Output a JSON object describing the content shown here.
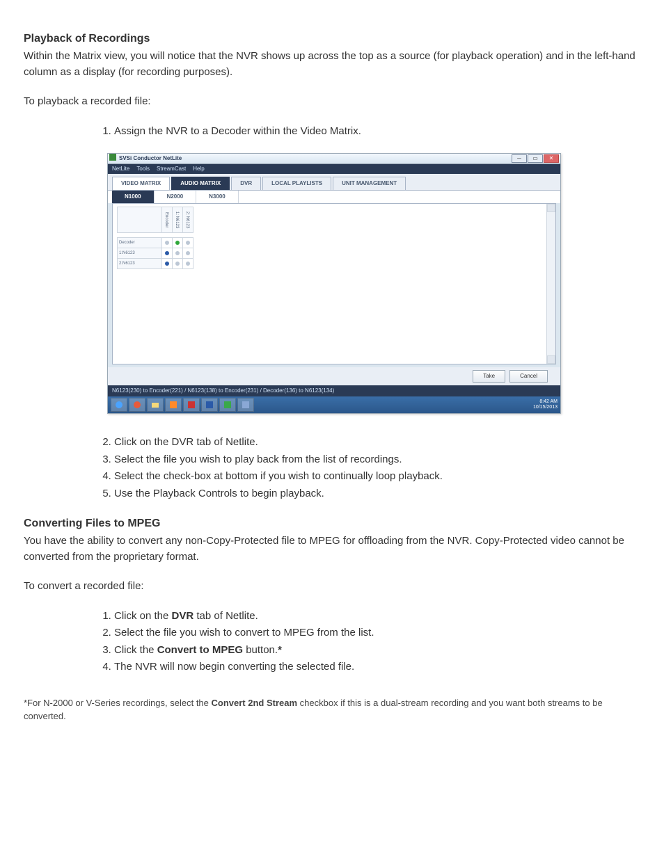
{
  "section1": {
    "heading": "Playback of Recordings",
    "para": "Within the Matrix view, you will notice that the NVR shows up across the top as a source (for playback operation) and in the left-hand column as a display (for recording purposes).",
    "intro": "To playback a recorded file:",
    "step1": "Assign the NVR to a Decoder within the Video Matrix."
  },
  "shot": {
    "title": "SVSi Conductor NetLite",
    "menu": [
      "NetLite",
      "Tools",
      "StreamCast",
      "Help"
    ],
    "tabs": {
      "video_matrix": "VIDEO MATRIX",
      "audio_matrix": "AUDIO MATRIX",
      "dvr": "DVR",
      "local_playlists": "LOCAL PLAYLISTS",
      "unit_management": "UNIT MANAGEMENT"
    },
    "subtabs": {
      "n1000": "N1000",
      "n2000": "N2000",
      "n3000": "N3000"
    },
    "cols": {
      "encoder": "Encoder",
      "c1": "1: N6123",
      "c2": "2: N6123"
    },
    "rows": {
      "decoder": "Decoder",
      "r1": "1:N6123",
      "r2": "2:N6123"
    },
    "buttons": {
      "take": "Take",
      "cancel": "Cancel"
    },
    "status": "N6123(230) to Encoder(221) / N6123(138) to Encoder(231) / Decoder(136) to N6123(134)",
    "clock": {
      "time": "8:42 AM",
      "date": "10/15/2013"
    }
  },
  "section2": {
    "step2": "Click on the DVR tab of Netlite.",
    "step3": "Select the file you wish to play back from the list of recordings.",
    "step4": "Select the check-box at bottom if you wish to continually loop playback.",
    "step5": "Use the Playback Controls to begin playback."
  },
  "section3": {
    "heading": "Converting Files to MPEG",
    "para": "You have the ability to convert any non-Copy-Protected file to MPEG for offloading from the NVR. Copy-Protected video cannot be converted from the proprietary format.",
    "intro": "To convert a recorded file:",
    "li1_a": "Click on the ",
    "li1_b": "DVR",
    "li1_c": " tab of Netlite.",
    "li2": "Select the file you wish to convert to MPEG from the list.",
    "li3_a": "Click the ",
    "li3_b": "Convert to MPEG",
    "li3_c": " button.",
    "li3_d": "*",
    "li4": "The NVR will now begin converting the selected file."
  },
  "footnote": {
    "a": "*For N-2000 or V-Series recordings, select the ",
    "b": "Convert 2nd Stream",
    "c": " checkbox if this is a dual-stream recording and you want both streams to be converted."
  }
}
